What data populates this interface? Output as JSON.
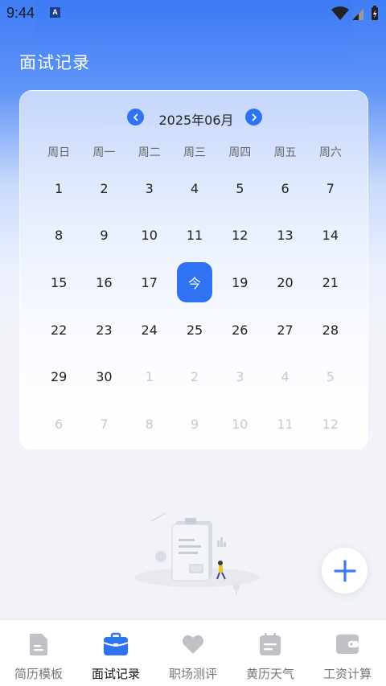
{
  "status_bar": {
    "time": "9:44",
    "app_badge": "A"
  },
  "page": {
    "title": "面试记录"
  },
  "calendar": {
    "month_label": "2025年06月",
    "weekdays": [
      "周日",
      "周一",
      "周二",
      "周三",
      "周四",
      "周五",
      "周六"
    ],
    "today_label": "今",
    "days": [
      {
        "label": "1",
        "muted": false
      },
      {
        "label": "2",
        "muted": false
      },
      {
        "label": "3",
        "muted": false
      },
      {
        "label": "4",
        "muted": false
      },
      {
        "label": "5",
        "muted": false
      },
      {
        "label": "6",
        "muted": false
      },
      {
        "label": "7",
        "muted": false
      },
      {
        "label": "8",
        "muted": false
      },
      {
        "label": "9",
        "muted": false
      },
      {
        "label": "10",
        "muted": false
      },
      {
        "label": "11",
        "muted": false
      },
      {
        "label": "12",
        "muted": false
      },
      {
        "label": "13",
        "muted": false
      },
      {
        "label": "14",
        "muted": false
      },
      {
        "label": "15",
        "muted": false
      },
      {
        "label": "16",
        "muted": false
      },
      {
        "label": "17",
        "muted": false
      },
      {
        "label": "今",
        "muted": false,
        "today": true
      },
      {
        "label": "19",
        "muted": false
      },
      {
        "label": "20",
        "muted": false
      },
      {
        "label": "21",
        "muted": false
      },
      {
        "label": "22",
        "muted": false
      },
      {
        "label": "23",
        "muted": false
      },
      {
        "label": "24",
        "muted": false
      },
      {
        "label": "25",
        "muted": false
      },
      {
        "label": "26",
        "muted": false
      },
      {
        "label": "27",
        "muted": false
      },
      {
        "label": "28",
        "muted": false
      },
      {
        "label": "29",
        "muted": false
      },
      {
        "label": "30",
        "muted": false
      },
      {
        "label": "1",
        "muted": true
      },
      {
        "label": "2",
        "muted": true
      },
      {
        "label": "3",
        "muted": true
      },
      {
        "label": "4",
        "muted": true
      },
      {
        "label": "5",
        "muted": true
      },
      {
        "label": "6",
        "muted": true
      },
      {
        "label": "7",
        "muted": true
      },
      {
        "label": "8",
        "muted": true
      },
      {
        "label": "9",
        "muted": true
      },
      {
        "label": "10",
        "muted": true
      },
      {
        "label": "11",
        "muted": true
      },
      {
        "label": "12",
        "muted": true
      }
    ]
  },
  "fab": {
    "icon": "plus-icon"
  },
  "bottom_nav": {
    "items": [
      {
        "label": "简历模板",
        "icon": "document-icon",
        "active": false
      },
      {
        "label": "面试记录",
        "icon": "briefcase-icon",
        "active": true
      },
      {
        "label": "职场测评",
        "icon": "heart-icon",
        "active": false
      },
      {
        "label": "黄历天气",
        "icon": "calendar-icon",
        "active": false
      },
      {
        "label": "工资计算",
        "icon": "wallet-icon",
        "active": false
      }
    ]
  },
  "colors": {
    "accent": "#2f73f2",
    "inactive_icon": "#bfc1c7",
    "background": "#f2f3f8"
  }
}
